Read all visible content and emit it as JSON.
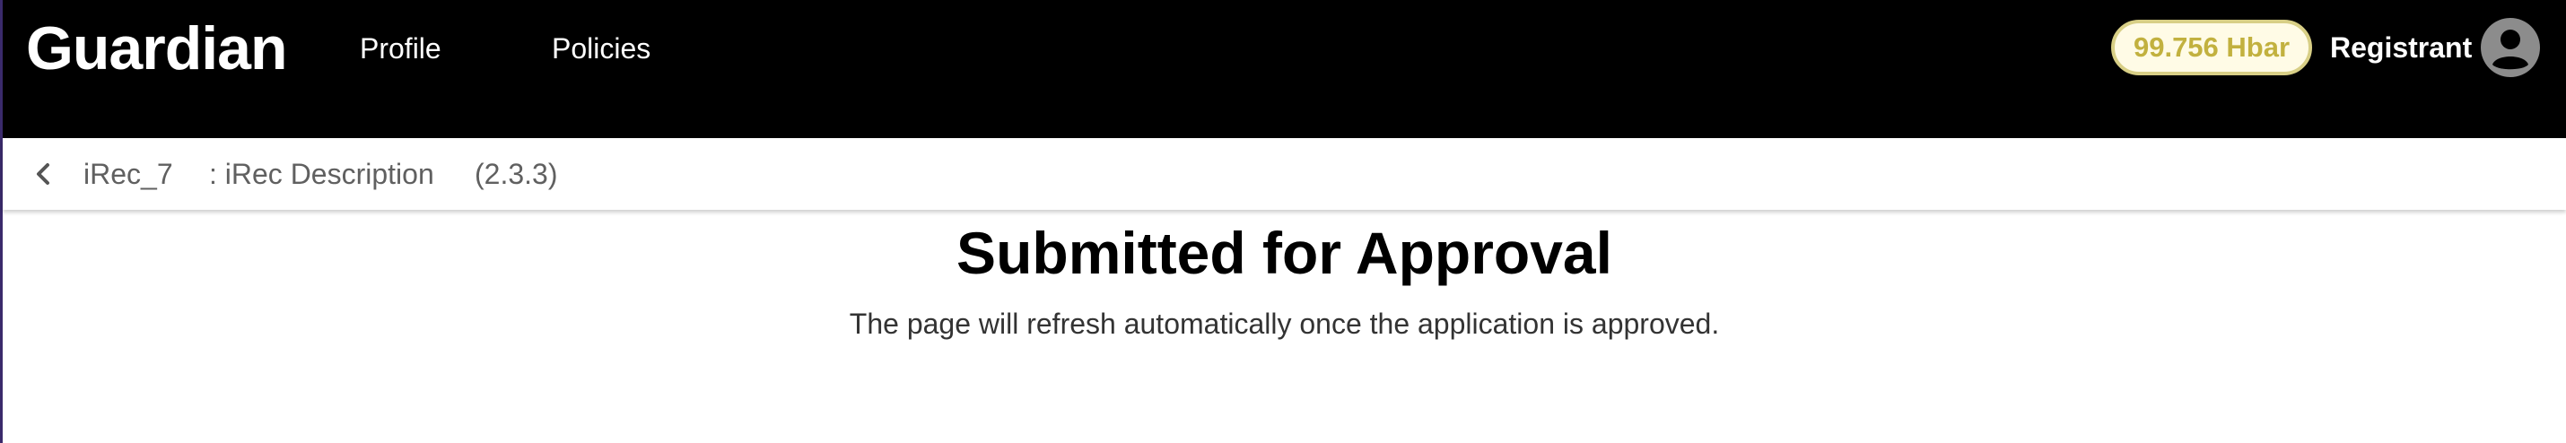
{
  "header": {
    "brand": "Guardian",
    "nav": [
      "Profile",
      "Policies"
    ],
    "balance": "99.756 Hbar",
    "role": "Registrant",
    "avatar_icon": "account-circle-icon"
  },
  "breadcrumb": {
    "back_icon": "chevron-left-icon",
    "policy_name": "iRec_7",
    "policy_description": ": iRec Description",
    "version": "(2.3.3)"
  },
  "main": {
    "title": "Submitted for Approval",
    "message": "The page will refresh automatically once the application is approved."
  },
  "colors": {
    "header_bg": "#000000",
    "balance_text": "#c2b13f",
    "balance_border": "#d8cf86",
    "balance_bg": "#fffbe6"
  }
}
